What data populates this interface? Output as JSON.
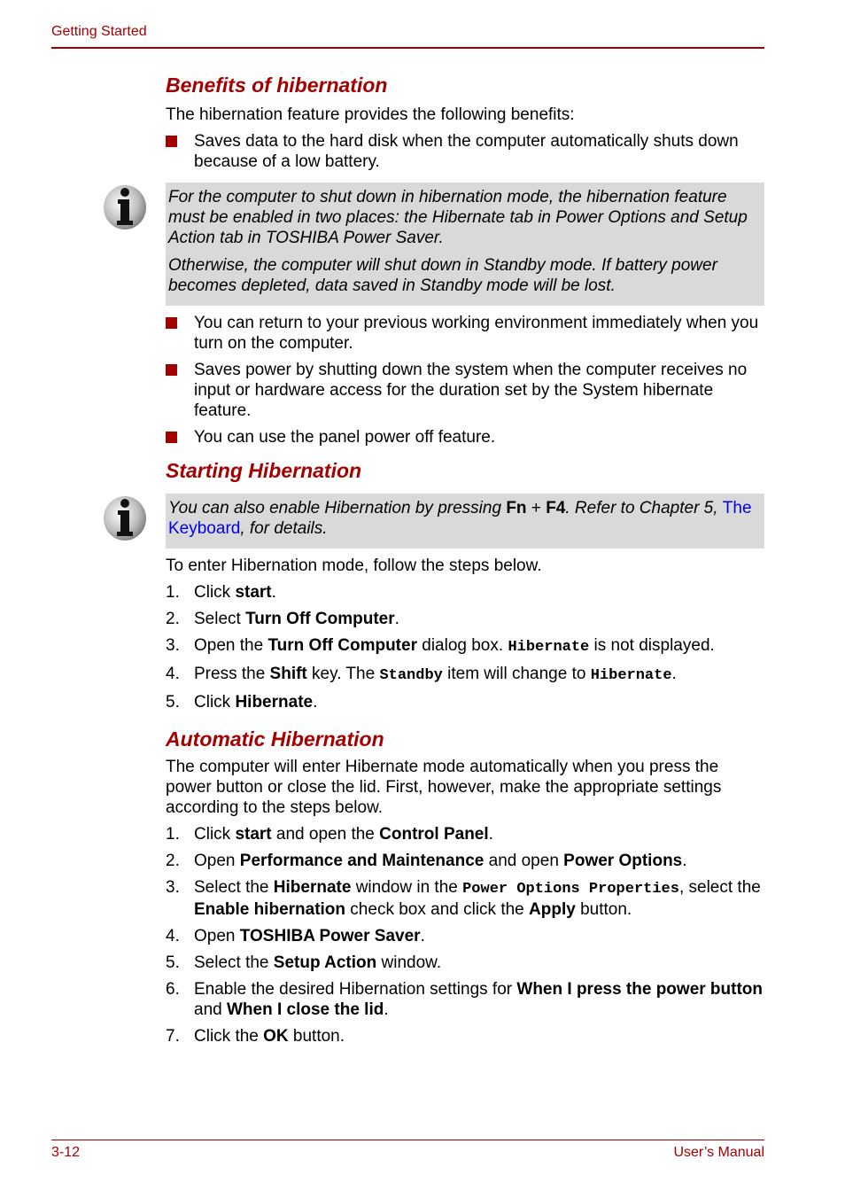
{
  "header": {
    "section": "Getting Started",
    "accent_color": "#a50000"
  },
  "footer": {
    "page_number": "3-12",
    "manual_title": "User’s Manual"
  },
  "benefits": {
    "heading": "Benefits of hibernation",
    "intro": "The hibernation feature provides the following benefits:",
    "bullet1": "Saves data to the hard disk when the computer automatically shuts down because of a low battery.",
    "note": {
      "icon": "info-icon",
      "para1": "For the computer to shut down in hibernation mode, the hibernation feature must be enabled in two places: the Hibernate tab in Power Options and Setup Action tab in TOSHIBA Power Saver.",
      "para2": "Otherwise, the computer will shut down in Standby mode. If battery power becomes depleted, data saved in Standby mode will be lost."
    },
    "bullets": [
      "You can return to your previous working environment immediately when you turn on the computer.",
      "Saves power by shutting down the system when the computer receives no input or hardware access for the duration set by the System hibernate feature.",
      "You can use the panel power off feature."
    ]
  },
  "starting": {
    "heading": "Starting Hibernation",
    "note": {
      "icon": "info-icon",
      "t1": "You can also enable Hibernation by pressing ",
      "k1": "Fn",
      "plus": " + ",
      "k2": "F4",
      "t2": ". Refer to Chapter 5, ",
      "link": "The Keyboard",
      "t3": ", for details."
    },
    "intro": "To enter Hibernation mode, follow the steps below.",
    "steps": [
      {
        "num": "1.",
        "a": "Click ",
        "b": "start",
        "c": "."
      },
      {
        "num": "2.",
        "a": "Select ",
        "b": "Turn Off Computer",
        "c": "."
      },
      {
        "num": "3.",
        "a": "Open the ",
        "b": "Turn Off Computer",
        "c": " dialog box. ",
        "m": "Hibernate",
        "d": " is not displayed."
      },
      {
        "num": "4.",
        "a": "Press the ",
        "b": "Shift",
        "c": " key. The ",
        "m": "Standby",
        "d": " item will change to ",
        "m2": "Hibernate",
        "e": "."
      },
      {
        "num": "5.",
        "a": "Click ",
        "b": "Hibernate",
        "c": "."
      }
    ]
  },
  "automatic": {
    "heading": "Automatic Hibernation",
    "intro": "The computer will enter Hibernate mode automatically when you press the power button or close the lid. First, however, make the appropriate settings according to the steps below.",
    "steps": [
      {
        "num": "1.",
        "a": "Click ",
        "b": "start",
        "c": " and open the ",
        "b2": "Control Panel",
        "d": "."
      },
      {
        "num": "2.",
        "a": "Open ",
        "b": "Performance and Maintenance",
        "c": " and open ",
        "b2": "Power Options",
        "d": "."
      },
      {
        "num": "3.",
        "a": "Select the ",
        "b": "Hibernate",
        "c": " window in the ",
        "m": "Power Options Properties",
        "d": ", select the ",
        "b2": "Enable hibernation",
        "e": " check box and click the ",
        "b3": "Apply",
        "f": " button."
      },
      {
        "num": "4.",
        "a": "Open ",
        "b": "TOSHIBA Power Saver",
        "c": "."
      },
      {
        "num": "5.",
        "a": "Select the ",
        "b": "Setup Action",
        "c": " window."
      },
      {
        "num": "6.",
        "a": "Enable the desired Hibernation settings for ",
        "b": "When I press the power button",
        "c": " and ",
        "b2": "When I close the lid",
        "d": "."
      },
      {
        "num": "7.",
        "a": "Click the ",
        "b": "OK",
        "c": " button."
      }
    ]
  }
}
